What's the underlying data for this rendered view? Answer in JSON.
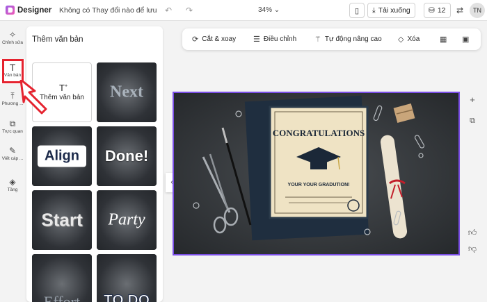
{
  "topbar": {
    "app_name": "Designer",
    "doc_status": "Không có Thay đổi nào để lưu",
    "zoom": "34%",
    "download_label": "Tải xuống",
    "credits": "12",
    "avatar": "TN"
  },
  "rail": {
    "items": [
      {
        "label": "Chỉnh sửa",
        "icon": "sparkle-icon"
      },
      {
        "label": "Văn bản",
        "icon": "text-icon"
      },
      {
        "label": "Phương ...",
        "icon": "upload-icon"
      },
      {
        "label": "Trực quan",
        "icon": "shapes-icon"
      },
      {
        "label": "Viết cáp ...",
        "icon": "pen-icon"
      },
      {
        "label": "Tầng",
        "icon": "layers-icon"
      }
    ]
  },
  "panel": {
    "title": "Thêm văn bản",
    "add_text_label": "Thêm văn bản",
    "tiles": [
      "Next",
      "Align",
      "Done!",
      "Start",
      "Party",
      "Effort",
      "TO DO"
    ]
  },
  "toolbar": {
    "crop": "Cắt & xoay",
    "adjust": "Điều chỉnh",
    "auto_enhance": "Tự động nâng cao",
    "erase": "Xóa"
  },
  "canvas": {
    "cert_title": "CONGRATULATIONS",
    "cert_subtitle": "YOUR YOUR GRADUTION!"
  },
  "colors": {
    "accent": "#7a4ee6",
    "highlight": "#e5232f"
  }
}
